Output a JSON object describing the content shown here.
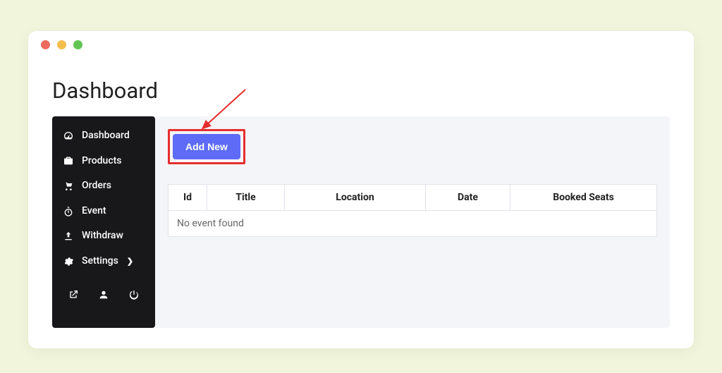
{
  "page": {
    "title": "Dashboard"
  },
  "sidebar": {
    "items": [
      {
        "label": "Dashboard"
      },
      {
        "label": "Products"
      },
      {
        "label": "Orders"
      },
      {
        "label": "Event"
      },
      {
        "label": "Withdraw"
      },
      {
        "label": "Settings"
      }
    ]
  },
  "main": {
    "add_button": "Add New",
    "table": {
      "headers": {
        "id": "Id",
        "title": "Title",
        "location": "Location",
        "date": "Date",
        "booked": "Booked Seats"
      },
      "empty_text": "No event found"
    }
  }
}
